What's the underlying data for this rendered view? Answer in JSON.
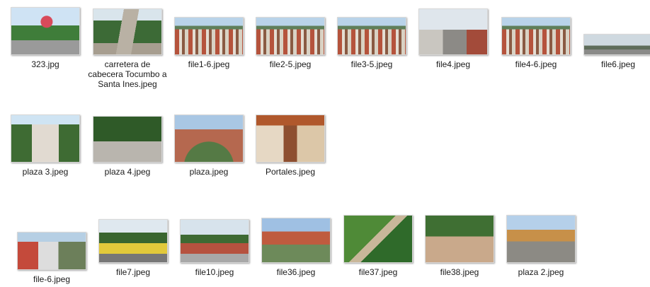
{
  "files": [
    {
      "name": "323.jpg",
      "thumb": "t-sign"
    },
    {
      "name": "carretera de cabecera Tocumbo a Santa Ines.jpeg",
      "thumb": "t-road"
    },
    {
      "name": "file1-6.jpeg",
      "thumb": "t-town"
    },
    {
      "name": "file2-5.jpeg",
      "thumb": "t-town"
    },
    {
      "name": "file3-5.jpeg",
      "thumb": "t-town"
    },
    {
      "name": "file4.jpeg",
      "thumb": "t-street"
    },
    {
      "name": "file4-6.jpeg",
      "thumb": "t-town"
    },
    {
      "name": "file6.jpeg",
      "thumb": "t-wide"
    },
    {
      "name": "plaza 3.jpeg",
      "thumb": "t-plaza3"
    },
    {
      "name": "plaza 4.jpeg",
      "thumb": "t-plaza4"
    },
    {
      "name": "plaza.jpeg",
      "thumb": "t-plaza"
    },
    {
      "name": "Portales.jpeg",
      "thumb": "t-portales"
    },
    {
      "name": "file-6.jpeg",
      "thumb": "t-file6"
    },
    {
      "name": "file7.jpeg",
      "thumb": "t-file7"
    },
    {
      "name": "file10.jpeg",
      "thumb": "t-file10"
    },
    {
      "name": "file36.jpeg",
      "thumb": "t-file36"
    },
    {
      "name": "file37.jpeg",
      "thumb": "t-file37"
    },
    {
      "name": "file38.jpeg",
      "thumb": "t-file38"
    },
    {
      "name": "plaza 2.jpeg",
      "thumb": "t-plaza2"
    }
  ]
}
